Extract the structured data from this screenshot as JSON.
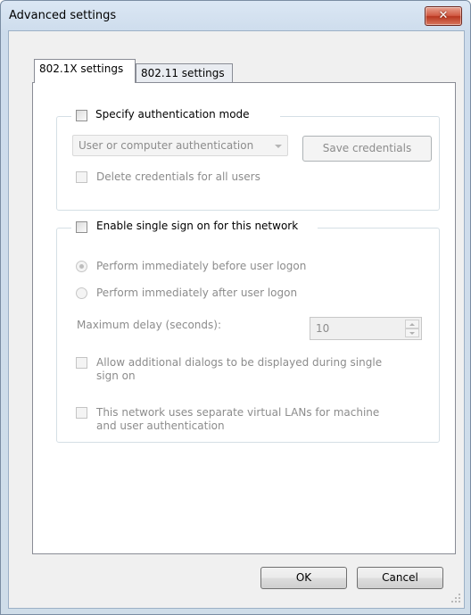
{
  "window": {
    "title": "Advanced settings",
    "close_glyph": "✕"
  },
  "tabs": [
    {
      "label": "802.1X settings",
      "active": true
    },
    {
      "label": "802.11 settings",
      "active": false
    }
  ],
  "auth_group": {
    "legend": "Specify authentication mode",
    "mode_select": {
      "value": "User or computer authentication"
    },
    "save_credentials_label": "Save credentials",
    "delete_credentials_label": "Delete credentials for all users"
  },
  "sso_group": {
    "legend": "Enable single sign on for this network",
    "radio_before": "Perform immediately before user logon",
    "radio_after": "Perform immediately after user logon",
    "max_delay_label": "Maximum delay (seconds):",
    "max_delay_value": "10",
    "allow_dialogs_line1": "Allow additional dialogs to be displayed during single",
    "allow_dialogs_line2": "sign on",
    "separate_vlans_line1": "This network uses separate virtual LANs for machine",
    "separate_vlans_line2": "and user authentication"
  },
  "footer": {
    "ok_label": "OK",
    "cancel_label": "Cancel"
  },
  "colors": {
    "close_red": "#c7432c",
    "disabled_text": "#8c8c8c"
  }
}
